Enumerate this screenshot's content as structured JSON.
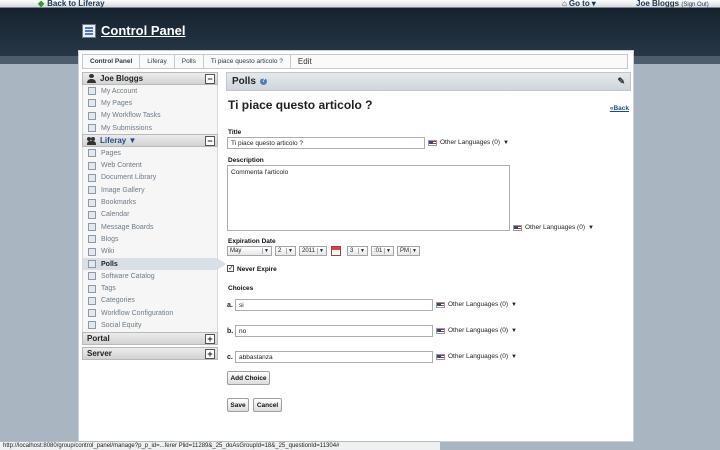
{
  "topbar": {
    "back_label": "Back to Liferay",
    "goto_label": "Go to",
    "user_name": "Joe Bloggs",
    "sign_out": "(Sign Out)"
  },
  "header": {
    "title": "Control Panel"
  },
  "breadcrumb": [
    "Control Panel",
    "Liferay",
    "Polls",
    "Ti piace questo articolo ?",
    "Edit"
  ],
  "sidebar": {
    "user_section": {
      "title": "Joe Bloggs",
      "items": [
        "My Account",
        "My Pages",
        "My Workflow Tasks",
        "My Submissions"
      ]
    },
    "site_section": {
      "title": "Liferay ▼",
      "items": [
        "Pages",
        "Web Content",
        "Document Library",
        "Image Gallery",
        "Bookmarks",
        "Calendar",
        "Message Boards",
        "Blogs",
        "Wiki",
        "Polls",
        "Software Catalog",
        "Tags",
        "Categories",
        "Workflow Configuration",
        "Social Equity"
      ],
      "active": "Polls"
    },
    "portal_section": {
      "title": "Portal"
    },
    "server_section": {
      "title": "Server"
    }
  },
  "portlet": {
    "title": "Polls",
    "help_icon": "?",
    "wrench_icon": "wrench-icon"
  },
  "form": {
    "heading": "Ti piace questo articolo ?",
    "back_link": "«Back",
    "title_label": "Title",
    "title_value": "Ti piace questo articolo ?",
    "description_label": "Description",
    "description_value": "Commenta l'articolo",
    "other_languages": "Other Languages (0)",
    "expiration_label": "Expiration Date",
    "month": "May",
    "day": "2",
    "year": "2011",
    "hour": "3",
    "minute": ":01",
    "ampm": "PM",
    "never_expire_label": "Never Expire",
    "never_expire_checked": "✓",
    "choices_label": "Choices",
    "choices": [
      {
        "letter": "a.",
        "value": "si"
      },
      {
        "letter": "b.",
        "value": "no"
      },
      {
        "letter": "c.",
        "value": "abbastanza"
      }
    ],
    "add_choice": "Add Choice",
    "save": "Save",
    "cancel": "Cancel"
  },
  "status_bar": "http://localhost:8080/group/control_panel/manage?p_p_id=...ferer Plid=11289&_25_doAsGroupId=18&_25_questionId=11304#"
}
